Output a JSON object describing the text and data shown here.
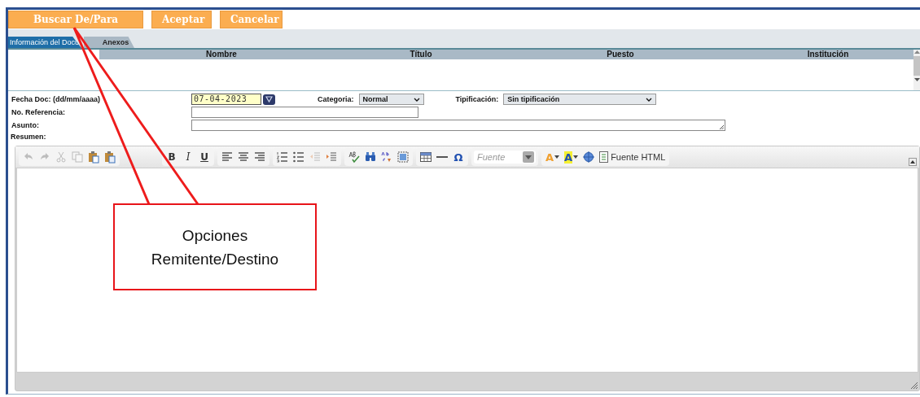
{
  "action_buttons": [
    {
      "label": "Buscar De/Para"
    },
    {
      "label": "Aceptar"
    },
    {
      "label": "Cancelar"
    }
  ],
  "tabs": [
    {
      "label": "Información del Docu.",
      "selected": true
    },
    {
      "label": "Anexos",
      "selected": false
    }
  ],
  "table": {
    "columns": [
      "Nombre",
      "Título",
      "Puesto",
      "Institución"
    ]
  },
  "form": {
    "date_label": "Fecha Doc: (dd/mm/aaaa)",
    "date_value": "07-04-2023",
    "category_label": "Categoria:",
    "category_value": "Normal",
    "type_label": "Tipificación:",
    "type_value": "Sin tipificación",
    "reference_label": "No. Referencia:",
    "subject_label": "Asunto:",
    "summary_label": "Resumen:"
  },
  "editor_toolbar": {
    "groups": [
      [
        {
          "disabled": true
        },
        {
          "disabled": true
        },
        {
          "disabled": true
        },
        {
          "disabled": true
        },
        {
          "disabled": false
        },
        {
          "disabled": false
        }
      ],
      [
        {
          "label": "B",
          "disabled": false
        },
        {
          "label": "I",
          "disabled": false
        },
        {
          "label": "U",
          "disabled": false
        }
      ],
      [
        {
          "disabled": false
        },
        {
          "disabled": false
        },
        {
          "disabled": false
        }
      ],
      [
        {
          "disabled": false
        },
        {
          "disabled": false
        },
        {
          "disabled": true
        },
        {
          "disabled": false
        }
      ],
      [
        {
          "disabled": false
        },
        {
          "disabled": false
        },
        {
          "disabled": false
        },
        {
          "disabled": false
        }
      ],
      [
        {
          "disabled": false
        },
        {
          "disabled": false
        },
        {
          "label": "Ω",
          "disabled": false
        }
      ]
    ],
    "font_combo": {
      "placeholder": "Fuente"
    },
    "color_buttons": [
      {
        "label": "A",
        "color": "#f0a030"
      },
      {
        "label": "A",
        "color": "#f5f032"
      }
    ],
    "source_button": {
      "label": "Fuente HTML"
    }
  },
  "callout": {
    "text": "Opciones Remitente/Destino"
  }
}
